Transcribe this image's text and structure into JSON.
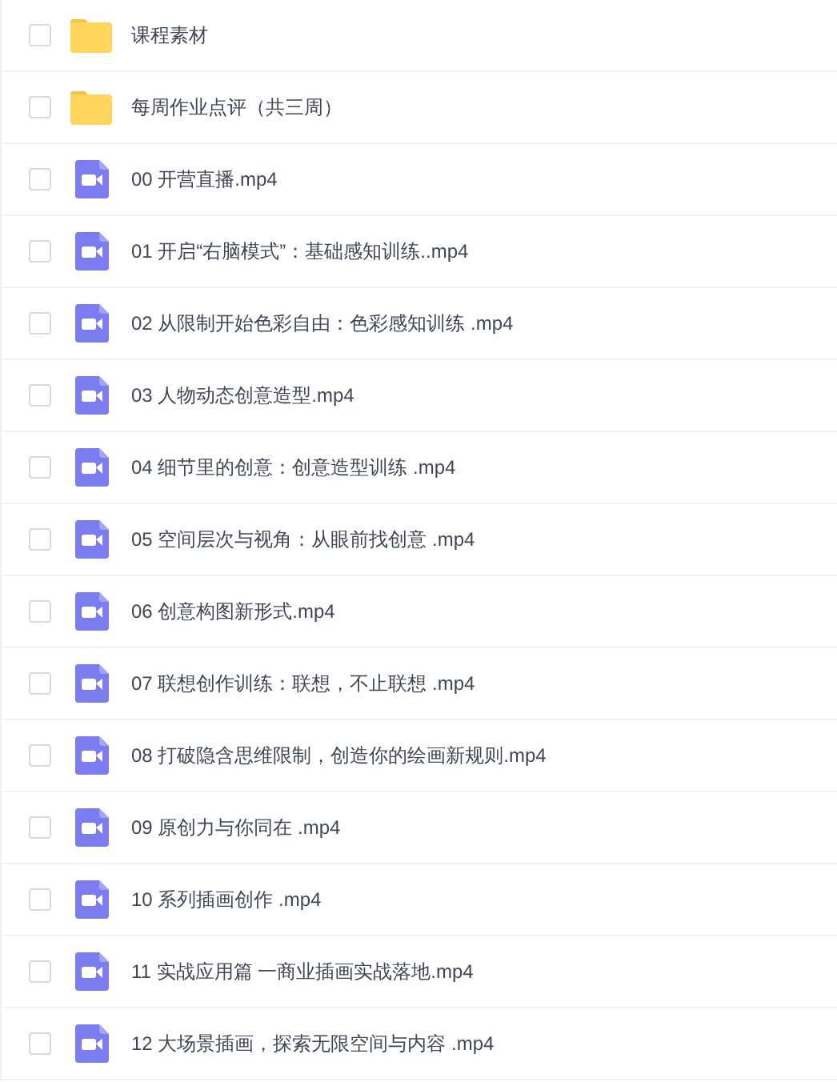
{
  "files": [
    {
      "kind": "folder",
      "name": "课程素材",
      "checked": false
    },
    {
      "kind": "folder",
      "name": "每周作业点评（共三周）",
      "checked": false
    },
    {
      "kind": "video",
      "name": "00 开营直播.mp4",
      "checked": false
    },
    {
      "kind": "video",
      "name": "01 开启“右脑模式”：基础感知训练..mp4",
      "checked": false
    },
    {
      "kind": "video",
      "name": "02 从限制开始色彩自由：色彩感知训练 .mp4",
      "checked": false
    },
    {
      "kind": "video",
      "name": "03 人物动态创意造型.mp4",
      "checked": false
    },
    {
      "kind": "video",
      "name": "04 细节里的创意：创意造型训练 .mp4",
      "checked": false
    },
    {
      "kind": "video",
      "name": "05 空间层次与视角：从眼前找创意 .mp4",
      "checked": false
    },
    {
      "kind": "video",
      "name": "06 创意构图新形式.mp4",
      "checked": false
    },
    {
      "kind": "video",
      "name": "07 联想创作训练：联想，不止联想 .mp4",
      "checked": false
    },
    {
      "kind": "video",
      "name": "08 打破隐含思维限制，创造你的绘画新规则.mp4",
      "checked": false
    },
    {
      "kind": "video",
      "name": "09 原创力与你同在 .mp4",
      "checked": false
    },
    {
      "kind": "video",
      "name": "10 系列插画创作 .mp4",
      "checked": false
    },
    {
      "kind": "video",
      "name": "11 实战应用篇 一商业插画实战落地.mp4",
      "checked": false
    },
    {
      "kind": "video",
      "name": "12 大场景插画，探索无限空间与内容 .mp4",
      "checked": false
    }
  ]
}
